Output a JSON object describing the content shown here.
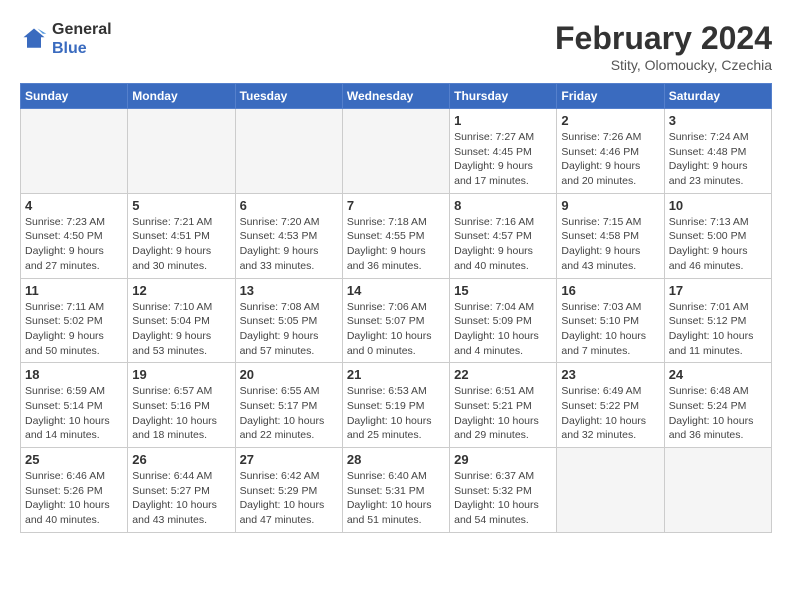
{
  "logo": {
    "line1": "General",
    "line2": "Blue"
  },
  "title": "February 2024",
  "location": "Stity, Olomoucky, Czechia",
  "weekdays": [
    "Sunday",
    "Monday",
    "Tuesday",
    "Wednesday",
    "Thursday",
    "Friday",
    "Saturday"
  ],
  "weeks": [
    [
      {
        "day": "",
        "info": ""
      },
      {
        "day": "",
        "info": ""
      },
      {
        "day": "",
        "info": ""
      },
      {
        "day": "",
        "info": ""
      },
      {
        "day": "1",
        "info": "Sunrise: 7:27 AM\nSunset: 4:45 PM\nDaylight: 9 hours\nand 17 minutes."
      },
      {
        "day": "2",
        "info": "Sunrise: 7:26 AM\nSunset: 4:46 PM\nDaylight: 9 hours\nand 20 minutes."
      },
      {
        "day": "3",
        "info": "Sunrise: 7:24 AM\nSunset: 4:48 PM\nDaylight: 9 hours\nand 23 minutes."
      }
    ],
    [
      {
        "day": "4",
        "info": "Sunrise: 7:23 AM\nSunset: 4:50 PM\nDaylight: 9 hours\nand 27 minutes."
      },
      {
        "day": "5",
        "info": "Sunrise: 7:21 AM\nSunset: 4:51 PM\nDaylight: 9 hours\nand 30 minutes."
      },
      {
        "day": "6",
        "info": "Sunrise: 7:20 AM\nSunset: 4:53 PM\nDaylight: 9 hours\nand 33 minutes."
      },
      {
        "day": "7",
        "info": "Sunrise: 7:18 AM\nSunset: 4:55 PM\nDaylight: 9 hours\nand 36 minutes."
      },
      {
        "day": "8",
        "info": "Sunrise: 7:16 AM\nSunset: 4:57 PM\nDaylight: 9 hours\nand 40 minutes."
      },
      {
        "day": "9",
        "info": "Sunrise: 7:15 AM\nSunset: 4:58 PM\nDaylight: 9 hours\nand 43 minutes."
      },
      {
        "day": "10",
        "info": "Sunrise: 7:13 AM\nSunset: 5:00 PM\nDaylight: 9 hours\nand 46 minutes."
      }
    ],
    [
      {
        "day": "11",
        "info": "Sunrise: 7:11 AM\nSunset: 5:02 PM\nDaylight: 9 hours\nand 50 minutes."
      },
      {
        "day": "12",
        "info": "Sunrise: 7:10 AM\nSunset: 5:04 PM\nDaylight: 9 hours\nand 53 minutes."
      },
      {
        "day": "13",
        "info": "Sunrise: 7:08 AM\nSunset: 5:05 PM\nDaylight: 9 hours\nand 57 minutes."
      },
      {
        "day": "14",
        "info": "Sunrise: 7:06 AM\nSunset: 5:07 PM\nDaylight: 10 hours\nand 0 minutes."
      },
      {
        "day": "15",
        "info": "Sunrise: 7:04 AM\nSunset: 5:09 PM\nDaylight: 10 hours\nand 4 minutes."
      },
      {
        "day": "16",
        "info": "Sunrise: 7:03 AM\nSunset: 5:10 PM\nDaylight: 10 hours\nand 7 minutes."
      },
      {
        "day": "17",
        "info": "Sunrise: 7:01 AM\nSunset: 5:12 PM\nDaylight: 10 hours\nand 11 minutes."
      }
    ],
    [
      {
        "day": "18",
        "info": "Sunrise: 6:59 AM\nSunset: 5:14 PM\nDaylight: 10 hours\nand 14 minutes."
      },
      {
        "day": "19",
        "info": "Sunrise: 6:57 AM\nSunset: 5:16 PM\nDaylight: 10 hours\nand 18 minutes."
      },
      {
        "day": "20",
        "info": "Sunrise: 6:55 AM\nSunset: 5:17 PM\nDaylight: 10 hours\nand 22 minutes."
      },
      {
        "day": "21",
        "info": "Sunrise: 6:53 AM\nSunset: 5:19 PM\nDaylight: 10 hours\nand 25 minutes."
      },
      {
        "day": "22",
        "info": "Sunrise: 6:51 AM\nSunset: 5:21 PM\nDaylight: 10 hours\nand 29 minutes."
      },
      {
        "day": "23",
        "info": "Sunrise: 6:49 AM\nSunset: 5:22 PM\nDaylight: 10 hours\nand 32 minutes."
      },
      {
        "day": "24",
        "info": "Sunrise: 6:48 AM\nSunset: 5:24 PM\nDaylight: 10 hours\nand 36 minutes."
      }
    ],
    [
      {
        "day": "25",
        "info": "Sunrise: 6:46 AM\nSunset: 5:26 PM\nDaylight: 10 hours\nand 40 minutes."
      },
      {
        "day": "26",
        "info": "Sunrise: 6:44 AM\nSunset: 5:27 PM\nDaylight: 10 hours\nand 43 minutes."
      },
      {
        "day": "27",
        "info": "Sunrise: 6:42 AM\nSunset: 5:29 PM\nDaylight: 10 hours\nand 47 minutes."
      },
      {
        "day": "28",
        "info": "Sunrise: 6:40 AM\nSunset: 5:31 PM\nDaylight: 10 hours\nand 51 minutes."
      },
      {
        "day": "29",
        "info": "Sunrise: 6:37 AM\nSunset: 5:32 PM\nDaylight: 10 hours\nand 54 minutes."
      },
      {
        "day": "",
        "info": ""
      },
      {
        "day": "",
        "info": ""
      }
    ]
  ]
}
